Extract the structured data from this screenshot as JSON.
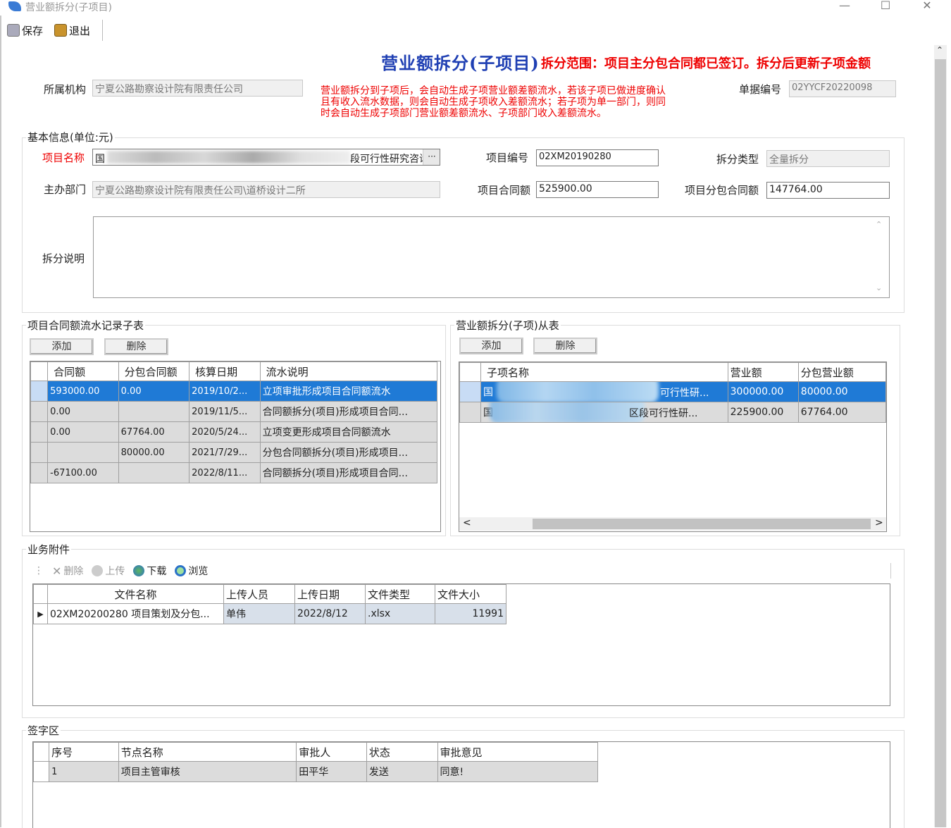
{
  "window": {
    "title": "营业额拆分(子项目)",
    "minimize": "—",
    "maximize": "☐",
    "close": "✕"
  },
  "toolbar": {
    "save": "保存",
    "exit": "退出"
  },
  "header": {
    "title": "营业额拆分(子项目)",
    "subtitle": "拆分范围：项目主分包合同都已签订。拆分后更新子项金额",
    "note": "营业额拆分到子项后，会自动生成子项营业额差额流水，若该子项已做进度确认且有收入流水数据，则会自动生成子项收入差额流水；若子项为单一部门，则同时会自动生成子项部门营业额差额流水、子项部门收入差额流水。"
  },
  "org": {
    "label": "所属机构",
    "value": "宁夏公路勘察设计院有限责任公司"
  },
  "docno": {
    "label": "单据编号",
    "value": "02YYCF20220098"
  },
  "basic": {
    "title": "基本信息(单位:元)",
    "project_name_label": "项目名称",
    "project_name_prefix": "国",
    "project_name_suffix": "段可行性研究咨询服务",
    "browse_btn": "···",
    "project_no_label": "项目编号",
    "project_no": "02XM20190280",
    "split_type_label": "拆分类型",
    "split_type": "全量拆分",
    "dept_label": "主办部门",
    "dept": "宁夏公路勘察设计院有限责任公司\\道桥设计二所",
    "contract_label": "项目合同额",
    "contract": "525900.00",
    "sub_contract_label": "项目分包合同额",
    "sub_contract": "147764.00",
    "desc_label": "拆分说明",
    "desc": ""
  },
  "left_table": {
    "title": "项目合同额流水记录子表",
    "add": "添加",
    "delete": "删除",
    "columns": [
      "合同额",
      "分包合同额",
      "核算日期",
      "流水说明"
    ],
    "rows": [
      [
        "593000.00",
        "0.00",
        "2019/10/2...",
        "立项审批形成项目合同额流水"
      ],
      [
        "0.00",
        "",
        "2019/11/5...",
        "合同额拆分(项目)形成项目合同..."
      ],
      [
        "0.00",
        "67764.00",
        "2020/5/24...",
        "立项变更形成项目合同额流水"
      ],
      [
        "",
        "80000.00",
        "2021/7/29...",
        "分包合同额拆分(项目)形成项目..."
      ],
      [
        "-67100.00",
        "",
        "2022/8/11...",
        "合同额拆分(项目)形成项目合同..."
      ]
    ]
  },
  "right_table": {
    "title": "营业额拆分(子项)从表",
    "add": "添加",
    "delete": "删除",
    "columns": [
      "子项名称",
      "营业额",
      "分包营业额"
    ],
    "rows": [
      [
        "国",
        "可行性研...",
        "300000.00",
        "80000.00"
      ],
      [
        "国",
        "区段可行性研...",
        "225900.00",
        "67764.00"
      ]
    ],
    "scroll_left": "<",
    "scroll_right": ">"
  },
  "attachments": {
    "title": "业务附件",
    "toolbar": [
      "删除",
      "上传",
      "下载",
      "浏览"
    ],
    "columns": [
      "文件名称",
      "上传人员",
      "上传日期",
      "文件类型",
      "文件大小"
    ],
    "rows": [
      [
        "02XM20200280 项目策划及分包...",
        "单伟",
        "2022/8/12",
        ".xlsx",
        "11991"
      ]
    ]
  },
  "signature": {
    "title": "签字区",
    "columns": [
      "序号",
      "节点名称",
      "审批人",
      "状态",
      "审批意见"
    ],
    "rows": [
      [
        "1",
        "项目主管审核",
        "田平华",
        "发送",
        "同意!"
      ]
    ]
  }
}
